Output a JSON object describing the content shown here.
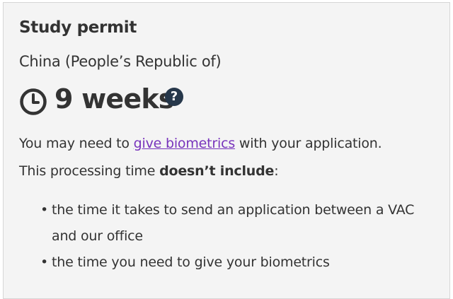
{
  "card": {
    "title": "Study permit",
    "country": "China (People’s Republic of)",
    "processing_time": "9 weeks",
    "help_icon_glyph": "?",
    "biometrics_prefix": "You may need to ",
    "biometrics_link": "give biometrics",
    "biometrics_suffix": " with your application.",
    "exclusion_prefix": "This processing time ",
    "exclusion_bold": "doesn’t include",
    "exclusion_suffix": ":",
    "bullet_glyph": "•",
    "list_items": [
      {
        "text": "the time it takes to send an application between a VAC and our office"
      },
      {
        "text": "the time you need to give your biometrics"
      }
    ]
  },
  "colors": {
    "text": "#333333",
    "link": "#7834bc",
    "help_icon_bg": "#26374a",
    "panel_bg": "#f4f4f4"
  },
  "icons": {
    "clock": "clock-icon",
    "help": "question-circle-icon"
  }
}
